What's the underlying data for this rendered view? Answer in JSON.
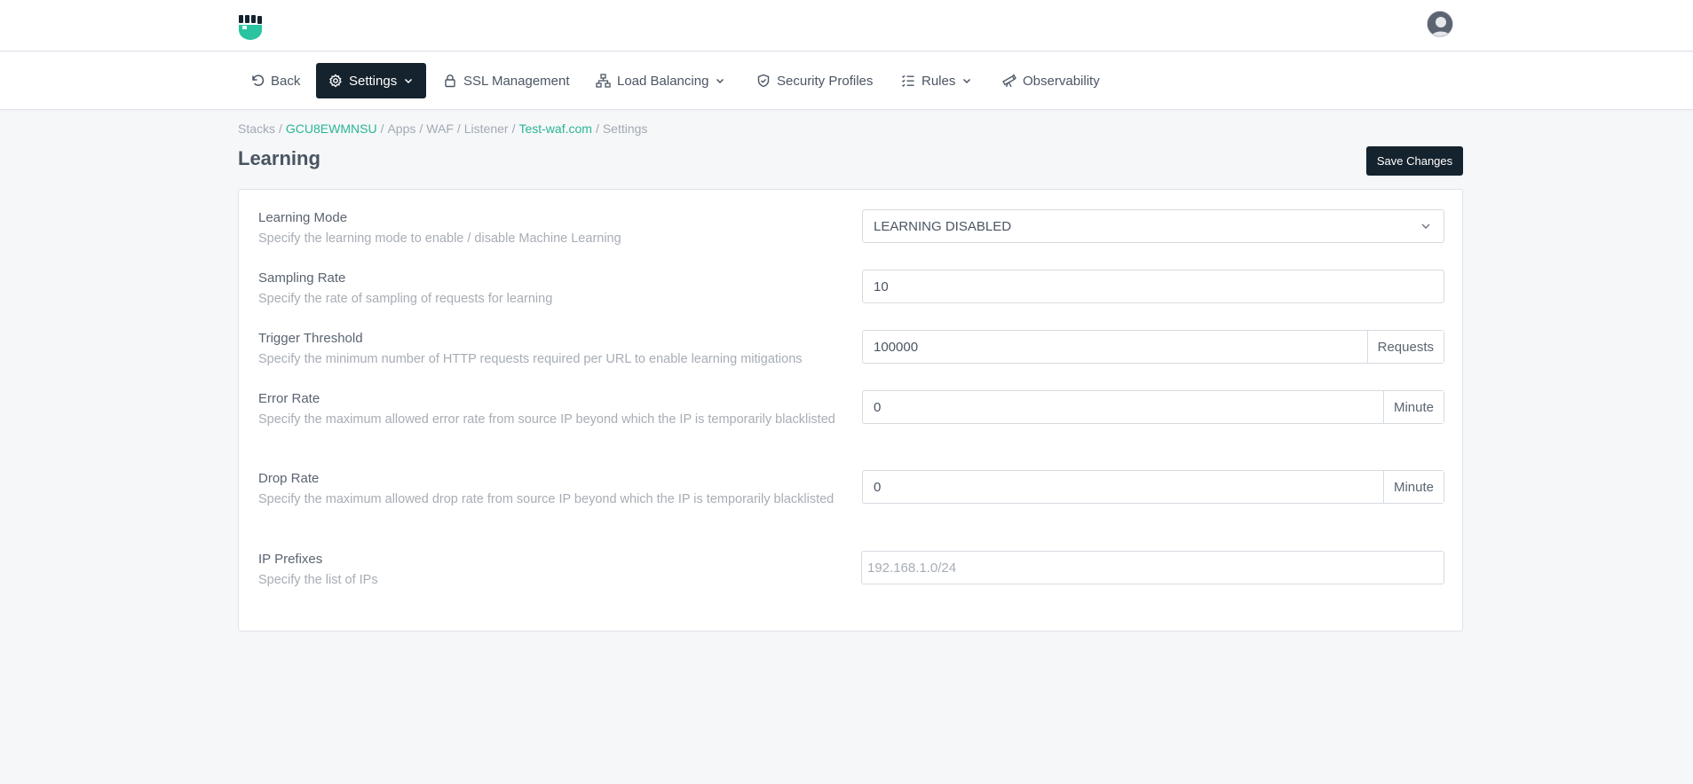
{
  "colors": {
    "accent": "#2bb594",
    "dark": "#15232e",
    "muted": "#a7adb5"
  },
  "topbar": {
    "logo_icon": "fist-logo-icon",
    "avatar_icon": "user-avatar-icon"
  },
  "nav": {
    "back": "Back",
    "settings": "Settings",
    "ssl": "SSL Management",
    "load_balancing": "Load Balancing",
    "security_profiles": "Security Profiles",
    "rules": "Rules",
    "observability": "Observability"
  },
  "breadcrumb": {
    "stacks": "Stacks",
    "stack_id": "GCU8EWMNSU",
    "apps": "Apps",
    "waf": "WAF",
    "listener": "Listener",
    "domain": "Test-waf.com",
    "current": "Settings",
    "separator": "/"
  },
  "page": {
    "title": "Learning",
    "save_label": "Save Changes"
  },
  "form": {
    "learning_mode": {
      "title": "Learning Mode",
      "desc": "Specify the learning mode to enable / disable Machine Learning",
      "value": "LEARNING DISABLED"
    },
    "sampling_rate": {
      "title": "Sampling Rate",
      "desc": "Specify the rate of sampling of requests for learning",
      "value": "10"
    },
    "trigger_threshold": {
      "title": "Trigger Threshold",
      "desc": "Specify the minimum number of HTTP requests required per URL to enable learning mitigations",
      "value": "100000",
      "unit": "Requests"
    },
    "error_rate": {
      "title": "Error Rate",
      "desc": "Specify the maximum allowed error rate from source IP beyond which the IP is temporarily blacklisted",
      "value": "0",
      "unit": "Minute"
    },
    "drop_rate": {
      "title": "Drop Rate",
      "desc": "Specify the maximum allowed drop rate from source IP beyond which the IP is temporarily blacklisted",
      "value": "0",
      "unit": "Minute"
    },
    "ip_prefixes": {
      "title": "IP Prefixes",
      "desc": "Specify the list of IPs",
      "placeholder": "192.168.1.0/24"
    }
  }
}
